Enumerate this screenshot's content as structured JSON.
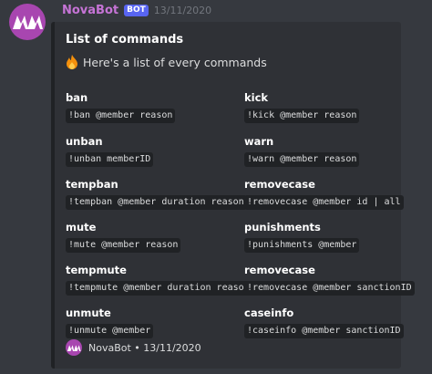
{
  "message": {
    "username": "NovaBot",
    "bot_tag": "BOT",
    "timestamp": "13/11/2020",
    "avatar_icon": "nova-logo-icon"
  },
  "embed": {
    "title": "List of commands",
    "description": "Here's a list of every commands",
    "description_icon": "fire-icon",
    "fields": [
      {
        "name": "ban",
        "value": "!ban @member reason"
      },
      {
        "name": "kick",
        "value": "!kick @member reason"
      },
      {
        "name": "unban",
        "value": "!unban memberID"
      },
      {
        "name": "warn",
        "value": "!warn @member reason"
      },
      {
        "name": "tempban",
        "value": "!tempban @member duration reason"
      },
      {
        "name": "removecase",
        "value": "!removecase @member id | all"
      },
      {
        "name": "mute",
        "value": "!mute @member reason"
      },
      {
        "name": "punishments",
        "value": "!punishments @member"
      },
      {
        "name": "tempmute",
        "value": "!tempmute @member duration reason"
      },
      {
        "name": "removecase",
        "value": "!removecase @member sanctionID"
      },
      {
        "name": "unmute",
        "value": "!unmute @member"
      },
      {
        "name": "caseinfo",
        "value": "!caseinfo @member sanctionID"
      }
    ],
    "footer": {
      "text": "NovaBot • 13/11/2020",
      "icon": "nova-logo-icon"
    }
  },
  "colors": {
    "background": "#36393f",
    "embed_background": "#2f3136",
    "username": "#c674d6",
    "avatar": "#a846b0",
    "bot_tag": "#5865f2"
  }
}
